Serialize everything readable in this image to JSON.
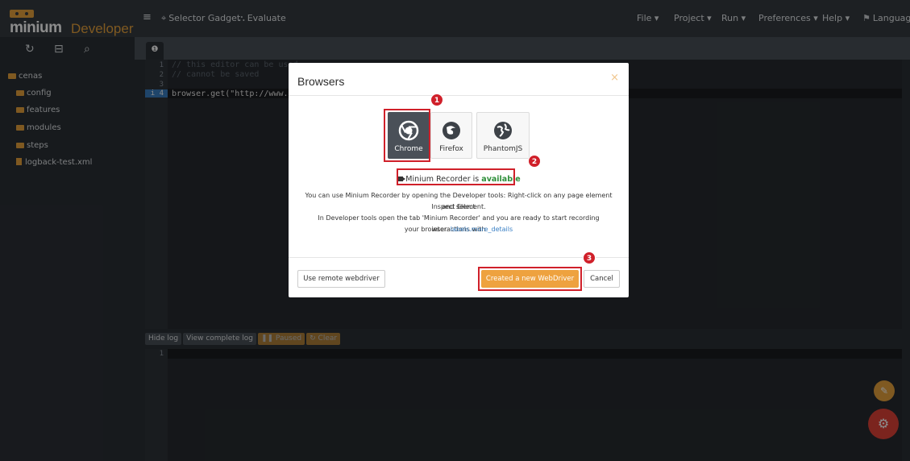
{
  "app": {
    "logo_main": "minium",
    "logo_sub": "Developer"
  },
  "topnav": {
    "menu_icon": "hamburger-icon",
    "selector_gadget": "Selector Gadget",
    "evaluate": "Evaluate",
    "file": "File ▾",
    "project": "Project ▾",
    "run": "Run ▾",
    "preferences": "Preferences ▾",
    "help": "Help ▾",
    "language": "Language"
  },
  "sidebar": {
    "tools": [
      "refresh-icon",
      "collapse-icon",
      "search-icon"
    ],
    "items": [
      {
        "label": "cenas",
        "type": "folder"
      },
      {
        "label": "config",
        "type": "folder"
      },
      {
        "label": "features",
        "type": "folder"
      },
      {
        "label": "modules",
        "type": "folder"
      },
      {
        "label": "steps",
        "type": "folder"
      },
      {
        "label": "logback-test.xml",
        "type": "file"
      }
    ]
  },
  "editor": {
    "tab_icon": "info-icon",
    "lines": [
      {
        "num": "1",
        "text": "// this editor can be used"
      },
      {
        "num": "2",
        "text": "// cannot be saved"
      },
      {
        "num": "3",
        "text": ""
      },
      {
        "num": "i 4",
        "text": "browser.get(\"http://www.goo"
      }
    ]
  },
  "log": {
    "hide": "Hide log",
    "view": "View complete log",
    "paused": "Paused",
    "clear": "Clear",
    "line": "1"
  },
  "modal": {
    "title": "Browsers",
    "close": "×",
    "browsers": [
      "Chrome",
      "Firefox",
      "PhantomJS"
    ],
    "recorder_prefix": "Minium Recorder is ",
    "recorder_status": "available",
    "desc_line1": "You can use Minium Recorder by opening the Developer tools: Right-click on any page element and select",
    "desc_line2": "Inspect Element.",
    "desc_line3": "In Developer tools open the tab 'Minium Recorder' and you are ready to start recording interactions with",
    "desc_line4_prefix": "your browser. ",
    "desc_link": "labels.more_details",
    "btn_remote": "Use remote webdriver",
    "btn_create": "Created a new WebDriver",
    "btn_cancel": "Cancel"
  },
  "annotations": [
    "1",
    "2",
    "3"
  ],
  "colors": {
    "accent": "#e8a33c",
    "annotation": "#d0202a",
    "available": "#2e8f3a"
  }
}
